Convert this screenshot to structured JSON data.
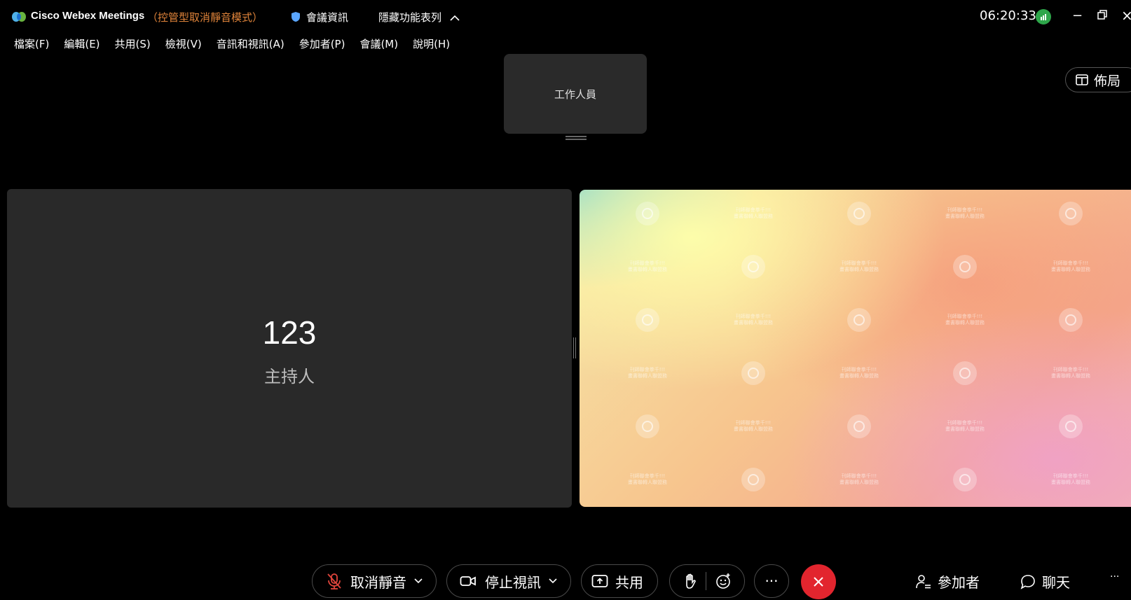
{
  "titlebar": {
    "app_title": "Cisco Webex Meetings",
    "mode": "（控管型取消靜音模式）",
    "meeting_info": "會議資訊",
    "hide_menu": "隱藏功能表列",
    "clock": "06:20:33",
    "minimize": "−",
    "close": "×"
  },
  "menu": [
    "檔案(F)",
    "編輯(E)",
    "共用(S)",
    "檢視(V)",
    "音訊和視訊(A)",
    "參加者(P)",
    "會議(M)",
    "說明(H)"
  ],
  "staff_tile": {
    "label": "工作人員"
  },
  "layout_button": {
    "label": "佈局"
  },
  "host_tile": {
    "name": "123",
    "role": "主持人"
  },
  "share_watermark": {
    "line1": "刊師聯會拳千!!!",
    "line2": "畫書聯轉人聯盟務"
  },
  "controls": {
    "unmute": "取消靜音",
    "stop_video": "停止視訊",
    "share": "共用",
    "more": "···",
    "participants": "參加者",
    "chat": "聊天",
    "overflow": "···"
  },
  "colors": {
    "accent_orange": "#e0843a",
    "end_call_red": "#e2252e",
    "signal_green": "#2ea64a",
    "tile_bg": "#292929"
  }
}
